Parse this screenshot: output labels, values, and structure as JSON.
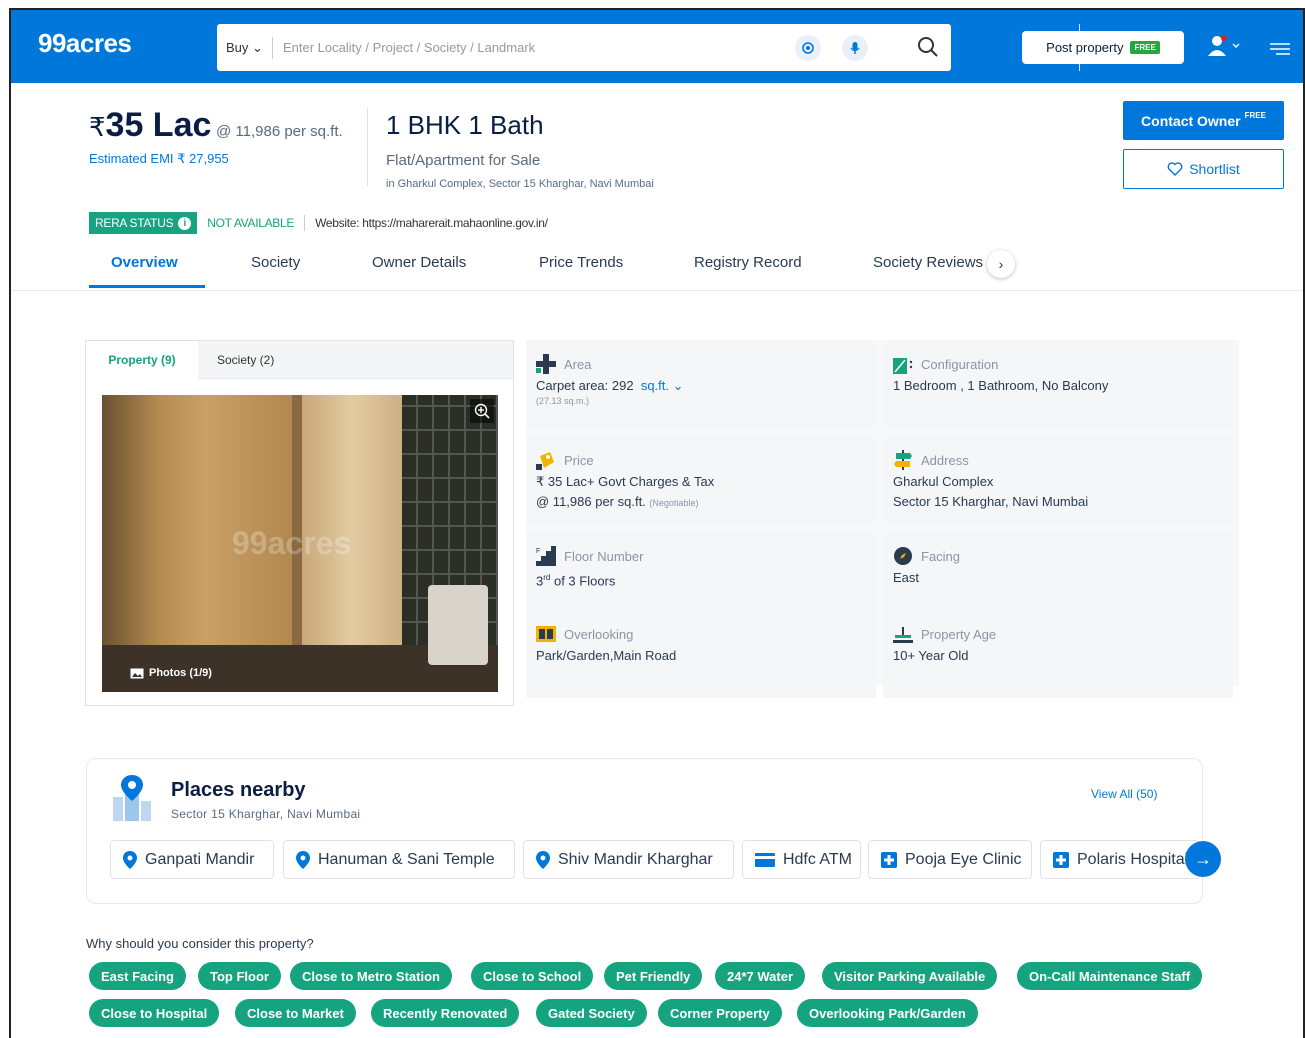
{
  "header": {
    "logo": "99acres",
    "buy_label": "Buy",
    "search_placeholder": "Enter Locality / Project / Society / Landmark",
    "post_property_label": "Post property",
    "post_property_tag": "FREE",
    "brand_color": "#0078db"
  },
  "listing": {
    "price_symbol": "₹",
    "price": "35 Lac",
    "per_sqft": "@ 11,986 per sq.ft.",
    "emi": "Estimated EMI ₹ 27,955",
    "title": "1 BHK 1 Bath",
    "type": "Flat/Apartment for Sale",
    "location": "in Gharkul Complex, Sector 15 Kharghar, Navi Mumbai",
    "contact_label": "Contact Owner",
    "contact_tag": "FREE",
    "shortlist_label": "Shortlist"
  },
  "rera": {
    "badge": "RERA STATUS",
    "status": "NOT AVAILABLE",
    "website": "Website: https://maharerait.mahaonline.gov.in/"
  },
  "nav_tabs": [
    "Overview",
    "Society",
    "Owner Details",
    "Price Trends",
    "Registry Record",
    "Society Reviews"
  ],
  "gallery": {
    "tabs": [
      "Property (9)",
      "Society (2)"
    ],
    "watermark": "99acres",
    "photos_label": "Photos (1/9)"
  },
  "details": [
    {
      "label": "Area",
      "value": "Carpet area: 292",
      "unit": "sq.ft.",
      "sub": "(27.13 sq.m.)",
      "icon": "area-icon"
    },
    {
      "label": "Configuration",
      "value": "1 Bedroom , 1 Bathroom, No Balcony",
      "icon": "configuration-icon"
    },
    {
      "label": "Price",
      "value": "₹ 35 Lac+ Govt Charges & Tax",
      "value2": "@ 11,986 per sq.ft.",
      "note": "(Negotiable)",
      "icon": "price-icon"
    },
    {
      "label": "Address",
      "value": "Gharkul Complex",
      "value2": "Sector 15 Kharghar, Navi Mumbai",
      "icon": "address-icon"
    },
    {
      "label": "Floor Number",
      "value": "3",
      "ordinal": "rd",
      "value_rest": " of 3 Floors",
      "icon": "floor-icon"
    },
    {
      "label": "Facing",
      "value": "East",
      "icon": "compass-icon"
    },
    {
      "label": "Overlooking",
      "value": "Park/Garden,Main Road",
      "icon": "overlooking-icon"
    },
    {
      "label": "Property Age",
      "value": "10+ Year Old",
      "icon": "property-age-icon"
    }
  ],
  "nearby": {
    "title": "Places nearby",
    "subtitle": "Sector 15 Kharghar, Navi Mumbai",
    "view_all": "View All (50)",
    "places": [
      {
        "name": "Ganpati Mandir",
        "icon": "location-pin-icon"
      },
      {
        "name": "Hanuman & Sani Temple",
        "icon": "location-pin-icon"
      },
      {
        "name": "Shiv Mandir Kharghar",
        "icon": "location-pin-icon"
      },
      {
        "name": "Hdfc ATM",
        "icon": "atm-icon"
      },
      {
        "name": "Pooja Eye Clinic",
        "icon": "hospital-icon"
      },
      {
        "name": "Polaris Hospital",
        "icon": "hospital-icon"
      }
    ]
  },
  "why": {
    "title": "Why should you consider this property?",
    "tags": [
      "East Facing",
      "Top Floor",
      "Close to Metro Station",
      "Close to School",
      "Pet Friendly",
      "24*7 Water",
      "Visitor Parking Available",
      "On-Call Maintenance Staff",
      "Close to Hospital",
      "Close to Market",
      "Recently Renovated",
      "Gated Society",
      "Corner Property",
      "Overlooking Park/Garden"
    ]
  }
}
